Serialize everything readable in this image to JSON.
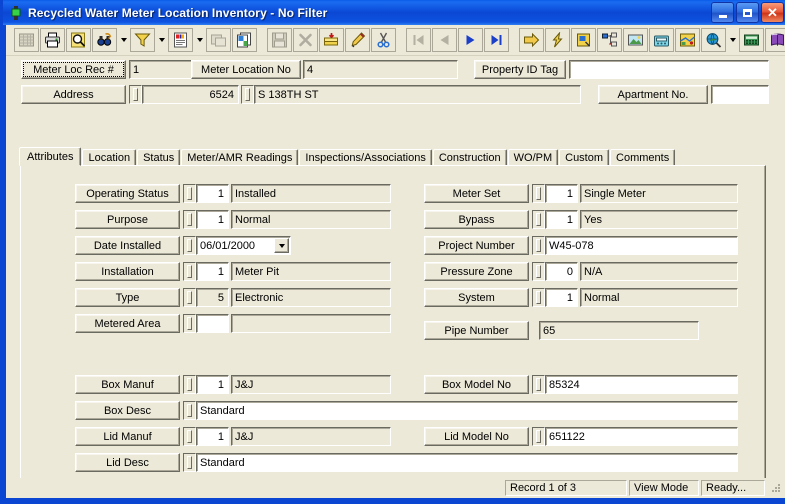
{
  "window": {
    "title": "Recycled Water Meter Location Inventory - No Filter",
    "icon": "meter-icon",
    "minimize_label": "Minimize",
    "maximize_label": "Maximize",
    "close_label": "Close"
  },
  "toolbar": {
    "items": [
      {
        "name": "grid-view-icon",
        "tooltip": "Grid View",
        "disabled": true,
        "framed": true
      },
      {
        "name": "print-icon",
        "tooltip": "Print",
        "disabled": false,
        "framed": true
      },
      {
        "name": "print-preview-icon",
        "tooltip": "Print Preview",
        "disabled": false,
        "framed": true
      },
      {
        "name": "find-icon",
        "tooltip": "Find",
        "disabled": false,
        "framed": true,
        "dropdown": true
      },
      {
        "name": "filter-icon",
        "tooltip": "Filter",
        "disabled": false,
        "framed": true,
        "dropdown": true
      },
      {
        "name": "report-icon",
        "tooltip": "Report",
        "disabled": false,
        "framed": true,
        "dropdown": true
      },
      {
        "name": "export-icon",
        "tooltip": "Export",
        "disabled": true,
        "framed": true
      },
      {
        "name": "copy-records-icon",
        "tooltip": "Copy Records",
        "disabled": false,
        "framed": true
      },
      {
        "name": "separator",
        "tooltip": "",
        "disabled": false,
        "framed": false
      },
      {
        "name": "save-icon",
        "tooltip": "Save",
        "disabled": true,
        "framed": true
      },
      {
        "name": "delete-icon",
        "tooltip": "Delete",
        "disabled": true,
        "framed": true
      },
      {
        "name": "new-record-icon",
        "tooltip": "New Record",
        "disabled": false,
        "framed": true
      },
      {
        "name": "edit-icon",
        "tooltip": "Edit",
        "disabled": false,
        "framed": true
      },
      {
        "name": "cut-icon",
        "tooltip": "Cut",
        "disabled": false,
        "framed": true
      },
      {
        "name": "separator",
        "tooltip": "",
        "disabled": false,
        "framed": false
      },
      {
        "name": "first-record-icon",
        "tooltip": "First Record",
        "disabled": true,
        "framed": true
      },
      {
        "name": "previous-record-icon",
        "tooltip": "Previous Record",
        "disabled": true,
        "framed": true
      },
      {
        "name": "next-record-icon",
        "tooltip": "Next Record",
        "disabled": false,
        "framed": true
      },
      {
        "name": "last-record-icon",
        "tooltip": "Last Record",
        "disabled": false,
        "framed": true
      },
      {
        "name": "separator",
        "tooltip": "",
        "disabled": false,
        "framed": false
      },
      {
        "name": "goto-icon",
        "tooltip": "Go To",
        "disabled": false,
        "framed": true
      },
      {
        "name": "quick-action-icon",
        "tooltip": "Quick Action",
        "disabled": false,
        "framed": true
      },
      {
        "name": "notes-icon",
        "tooltip": "Notes",
        "disabled": false,
        "framed": true
      },
      {
        "name": "hierarchy-icon",
        "tooltip": "Hierarchy",
        "disabled": false,
        "framed": true
      },
      {
        "name": "image-icon",
        "tooltip": "Image",
        "disabled": false,
        "framed": true
      },
      {
        "name": "phone-icon",
        "tooltip": "Phone",
        "disabled": false,
        "framed": true
      },
      {
        "name": "map-icon",
        "tooltip": "Map",
        "disabled": false,
        "framed": true
      },
      {
        "name": "gis-icon",
        "tooltip": "GIS",
        "disabled": false,
        "framed": true,
        "dropdown": true
      },
      {
        "name": "calculator-icon",
        "tooltip": "Calculator",
        "disabled": false,
        "framed": true
      },
      {
        "name": "help-book-icon",
        "tooltip": "Help",
        "disabled": false,
        "framed": true,
        "dropdown": true
      },
      {
        "name": "separator",
        "tooltip": "",
        "disabled": false,
        "framed": false
      },
      {
        "name": "exit-icon",
        "tooltip": "Exit",
        "disabled": false,
        "framed": true
      }
    ]
  },
  "header": {
    "meter_loc_rec_label": "Meter Loc Rec #",
    "meter_loc_rec_value": "1",
    "meter_location_no_label": "Meter Location No",
    "meter_location_no_value": "4",
    "property_id_tag_label": "Property ID Tag",
    "property_id_tag_value": "",
    "address_label": "Address",
    "address_number": "6524",
    "address_street": "S 138TH ST",
    "apartment_no_label": "Apartment No.",
    "apartment_no_value": ""
  },
  "tabs": [
    {
      "label": "Attributes",
      "active": true
    },
    {
      "label": "Location",
      "active": false
    },
    {
      "label": "Status",
      "active": false
    },
    {
      "label": "Meter/AMR Readings",
      "active": false
    },
    {
      "label": "Inspections/Associations",
      "active": false
    },
    {
      "label": "Construction",
      "active": false
    },
    {
      "label": "WO/PM",
      "active": false
    },
    {
      "label": "Custom",
      "active": false
    },
    {
      "label": "Comments",
      "active": false
    }
  ],
  "attributes": {
    "left": [
      {
        "label": "Operating Status",
        "code": "1",
        "code_editable": true,
        "desc": "Installed"
      },
      {
        "label": "Purpose",
        "code": "1",
        "code_editable": true,
        "desc": "Normal"
      },
      {
        "label": "Date Installed",
        "date": "06/01/2000"
      },
      {
        "label": "Installation",
        "code": "1",
        "code_editable": true,
        "desc": "Meter Pit"
      },
      {
        "label": "Type",
        "code": "5",
        "code_editable": false,
        "desc": "Electronic"
      },
      {
        "label": "Metered Area",
        "code": "",
        "code_editable": true,
        "desc": ""
      }
    ],
    "right": [
      {
        "label": "Meter Set",
        "code": "1",
        "code_editable": true,
        "desc": "Single Meter"
      },
      {
        "label": "Bypass",
        "code": "1",
        "code_editable": true,
        "desc": "Yes"
      },
      {
        "label": "Project Number",
        "text": "W45-078"
      },
      {
        "label": "Pressure Zone",
        "code": "0",
        "code_editable": true,
        "desc": "N/A"
      },
      {
        "label": "System",
        "code": "1",
        "code_editable": true,
        "desc": "Normal"
      },
      {
        "label": "Pipe Number",
        "readonly_text": "65"
      }
    ],
    "box_lid": {
      "box_manuf_label": "Box Manuf",
      "box_manuf_code": "1",
      "box_manuf_desc": "J&J",
      "box_model_no_label": "Box Model No",
      "box_model_no_value": "85324",
      "box_desc_label": "Box Desc",
      "box_desc_value": "Standard",
      "lid_manuf_label": "Lid Manuf",
      "lid_manuf_code": "1",
      "lid_manuf_desc": "J&J",
      "lid_model_no_label": "Lid Model No",
      "lid_model_no_value": "651122",
      "lid_desc_label": "Lid Desc",
      "lid_desc_value": "Standard"
    }
  },
  "statusbar": {
    "record": "Record 1 of 3",
    "mode": "View Mode",
    "state": "Ready..."
  },
  "colors": {
    "title_blue": "#0a46d2",
    "face": "#ece9d8",
    "shadow": "#aca899",
    "dark": "#6b6a60",
    "field_white": "#ffffff"
  }
}
